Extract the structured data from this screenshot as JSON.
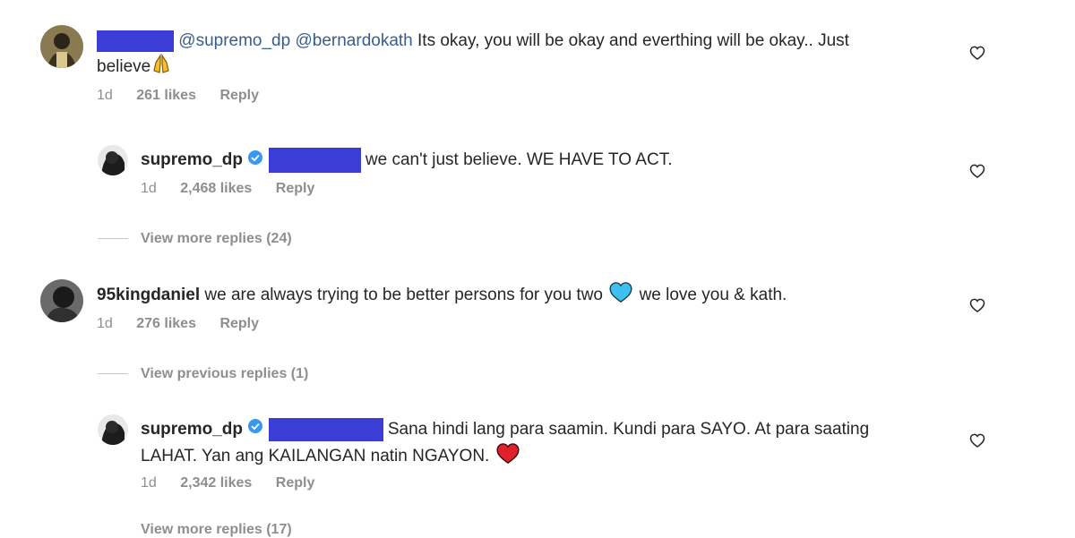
{
  "comments": [
    {
      "mentions": [
        "@supremo_dp",
        "@bernardokath"
      ],
      "text_line1": "Its okay, you will be okay and everthing will be okay.. Just",
      "text_line2": "believe",
      "emoji_icon": "praying-hands-icon",
      "time": "1d",
      "likes": "261 likes",
      "reply_label": "Reply"
    },
    {
      "username": "supremo_dp",
      "text": "we can't just believe. WE HAVE TO ACT.",
      "time": "1d",
      "likes": "2,468 likes",
      "reply_label": "Reply"
    },
    {
      "view_more": "View more replies (24)"
    },
    {
      "username": "95kingdaniel",
      "text_part1": "we are always trying to be better persons for you two",
      "emoji_icon": "blue-heart-icon",
      "text_part2": "we love you & kath.",
      "time": "1d",
      "likes": "276 likes",
      "reply_label": "Reply"
    },
    {
      "view_previous": "View previous replies (1)"
    },
    {
      "username": "supremo_dp",
      "text_line1": "Sana hindi lang para saamin. Kundi para SAYO. At para saating",
      "text_line2": "LAHAT. Yan ang KAILANGAN natin NGAYON.",
      "emoji_icon": "red-heart-icon",
      "time": "1d",
      "likes": "2,342 likes",
      "reply_label": "Reply"
    },
    {
      "view_more": "View more replies (17)"
    }
  ],
  "colors": {
    "redaction": "#3a3ed6",
    "verified": "#3897f0",
    "mention": "#385e8f",
    "meta": "#8e8e8e"
  }
}
